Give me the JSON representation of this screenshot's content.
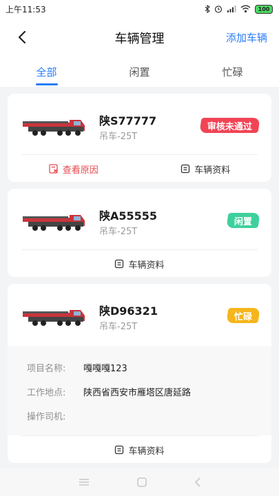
{
  "status_bar": {
    "time": "上午11:53",
    "battery": "100"
  },
  "header": {
    "title": "车辆管理",
    "add_label": "添加车辆"
  },
  "tabs": [
    {
      "label": "全部",
      "active": true
    },
    {
      "label": "闲置",
      "active": false
    },
    {
      "label": "忙碌",
      "active": false
    }
  ],
  "vehicles": [
    {
      "plate": "陕S77777",
      "type": "吊车-25T",
      "status": "审核未通过",
      "status_color": "#f24455",
      "actions": [
        "查看原因",
        "车辆资料"
      ]
    },
    {
      "plate": "陕A55555",
      "type": "吊车-25T",
      "status": "闲置",
      "status_color": "#3ed09c",
      "actions": [
        "车辆资料"
      ]
    },
    {
      "plate": "陕D96321",
      "type": "吊车-25T",
      "status": "忙碌",
      "status_color": "#f5b51b",
      "details": [
        {
          "label": "项目名称:",
          "value": "嘎嘎嘎123"
        },
        {
          "label": "工作地点:",
          "value": "陕西省西安市雁塔区唐延路"
        },
        {
          "label": "操作司机:",
          "value": ""
        }
      ],
      "actions": [
        "车辆资料"
      ]
    }
  ],
  "colors": {
    "accent": "#2a7cf7",
    "danger": "#e8474e"
  }
}
